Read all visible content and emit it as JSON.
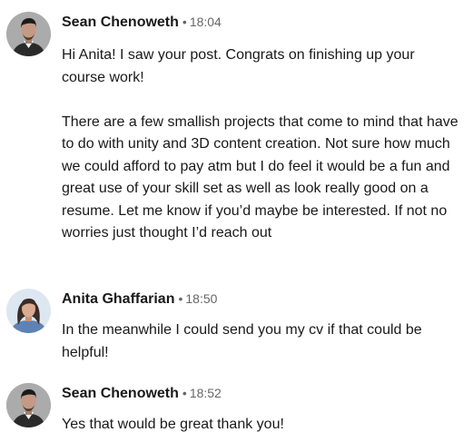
{
  "messages": [
    {
      "sender": "Sean Chenoweth",
      "separator": "•",
      "time": "18:04",
      "avatar_icon": "profile-photo-man",
      "paragraphs": [
        "Hi Anita! I saw your post. Congrats on finishing up your course work!",
        "There are a few smallish projects that come to mind that have to do with unity and 3D content creation. Not sure how much we could afford to pay atm but I do feel it would be a fun and great use of your skill set as well as look really good on a resume. Let me know if you’d maybe be interested. If not no worries just thought I’d reach out"
      ]
    },
    {
      "sender": "Anita Ghaffarian",
      "separator": "•",
      "time": "18:50",
      "avatar_icon": "profile-photo-woman",
      "paragraphs": [
        "In the meanwhile I could send you my cv if that could be helpful!"
      ]
    },
    {
      "sender": "Sean Chenoweth",
      "separator": "•",
      "time": "18:52",
      "avatar_icon": "profile-photo-man",
      "paragraphs": [
        "Yes that would be great thank you!"
      ]
    }
  ],
  "colors": {
    "text": "#1f1f1f",
    "meta": "#666666",
    "background": "#ffffff"
  }
}
